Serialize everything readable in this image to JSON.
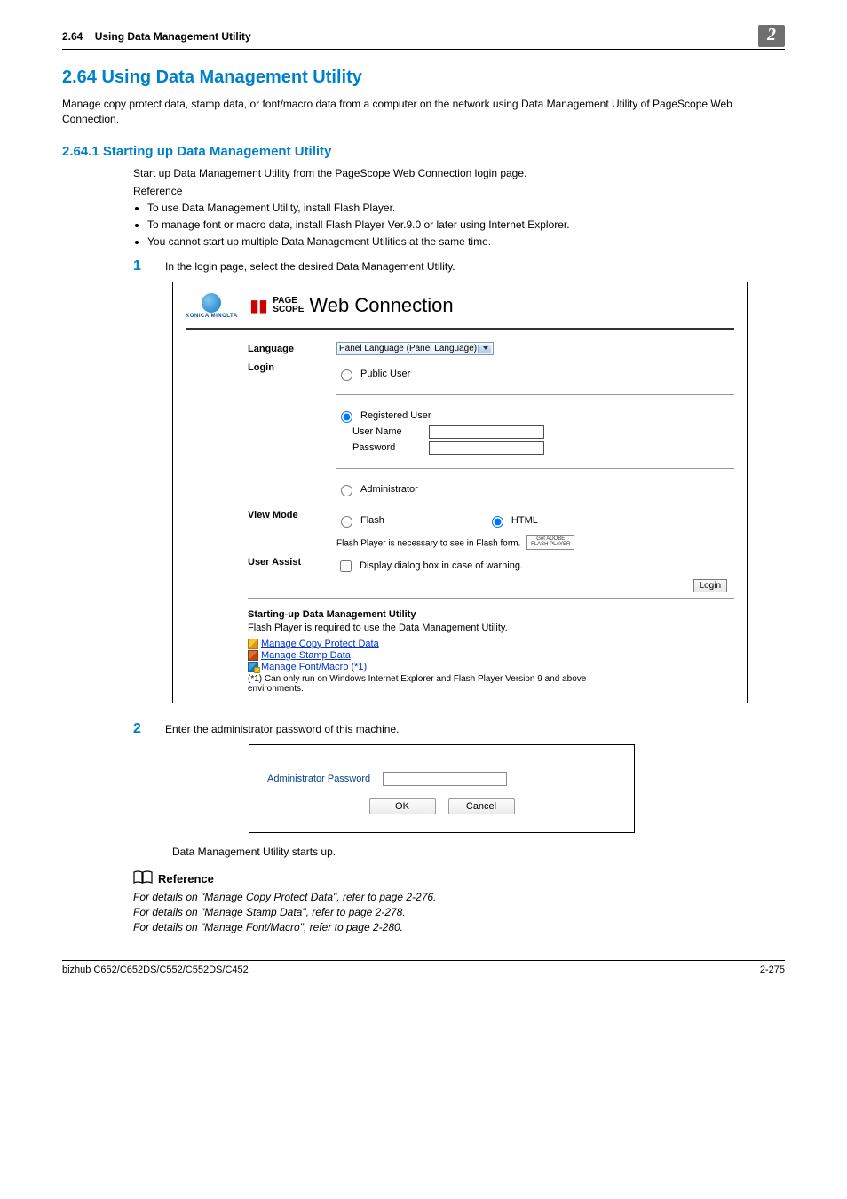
{
  "header": {
    "section_num_short": "2.64",
    "section_label": "Using Data Management Utility",
    "chapter_badge": "2"
  },
  "section_heading": "2.64    Using Data Management Utility",
  "intro": "Manage copy protect data, stamp data, or font/macro data from a computer on the network using Data Management Utility of PageScope Web Connection.",
  "subsection_heading": "2.64.1    Starting up Data Management Utility",
  "sub_intro": "Start up Data Management Utility from the PageScope Web Connection login page.",
  "reference_label": "Reference",
  "ref_bullets": [
    "To use Data Management Utility, install Flash Player.",
    "To manage font or macro data, install Flash Player Ver.9.0 or later using Internet Explorer.",
    "You cannot start up multiple Data Management Utilities at the same time."
  ],
  "step1": {
    "num": "1",
    "text": "In the login page, select the desired Data Management Utility."
  },
  "login_figure": {
    "km_text": "KONICA MINOLTA",
    "ps_small_top": "PAGE",
    "ps_small_bottom": "SCOPE",
    "ps_big": "Web Connection",
    "lang_label": "Language",
    "lang_value": "Panel Language (Panel Language)",
    "login_label": "Login",
    "radio_public": "Public User",
    "radio_registered": "Registered User",
    "username": "User Name",
    "password": "Password",
    "radio_admin": "Administrator",
    "view_label": "View Mode",
    "radio_flash": "Flash",
    "radio_html": "HTML",
    "flash_note": "Flash Player is necessary to see in Flash form.",
    "adobe_top": "Get ADOBE",
    "adobe_bot": "FLASH PLAYER",
    "assist_label": "User Assist",
    "assist_check": "Display dialog box in case of warning.",
    "login_btn": "Login",
    "dmu_title": "Starting-up Data Management Utility",
    "dmu_sub": "Flash Player is required to use the Data Management Utility.",
    "link1": "Manage Copy Protect Data",
    "link2": "Manage Stamp Data",
    "link3": "Manage Font/Macro (*1)",
    "dmu_foot": "(*1) Can only run on Windows Internet Explorer and Flash Player Version 9 and above environments."
  },
  "step2": {
    "num": "2",
    "text": "Enter the administrator password of this machine."
  },
  "pw_dialog": {
    "label": "Administrator Password",
    "ok": "OK",
    "cancel": "Cancel"
  },
  "after_dialog": "Data Management Utility starts up.",
  "ref_header": "Reference",
  "ref_lines": [
    "For details on \"Manage Copy Protect Data\", refer to page 2-276.",
    "For details on \"Manage Stamp Data\", refer to page 2-278.",
    "For details on \"Manage Font/Macro\", refer to page 2-280."
  ],
  "footer": {
    "left": "bizhub C652/C652DS/C552/C552DS/C452",
    "right": "2-275"
  }
}
